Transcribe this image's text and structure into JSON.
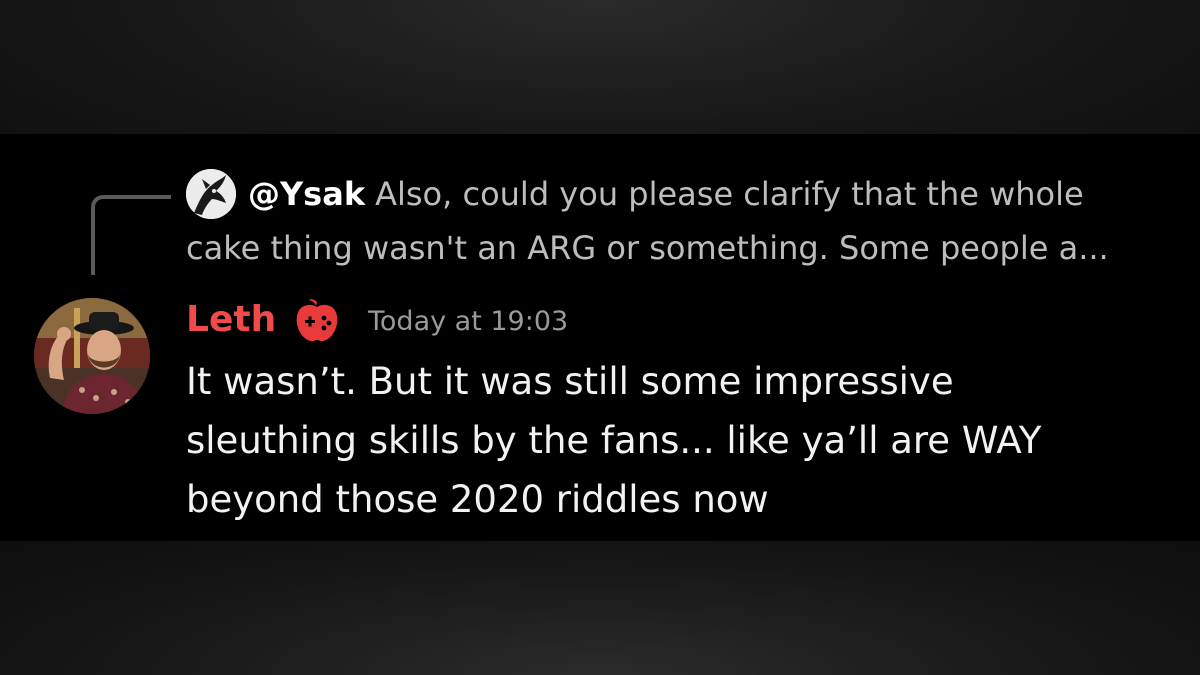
{
  "reply": {
    "username": "@Ysak",
    "text_line1": "Also, could you please clarify that the whole",
    "text_line2": "cake thing wasn't an ARG or something. Some people a..."
  },
  "message": {
    "author": "Leth",
    "timestamp": "Today at 19:03",
    "lines": [
      "It wasn’t. But it was still some impressive",
      "sleuthing skills by the fans... like ya’ll are WAY",
      "beyond those 2020 riddles now"
    ]
  },
  "icons": {
    "reply_connector": "reply-connector-line",
    "role_badge": "red-gamepad-apple-icon"
  },
  "colors": {
    "author_name": "#f04a4a",
    "timestamp": "#9a9a9a",
    "reply_text": "#bdbdbd",
    "message_text": "#f2f2f2",
    "panel_bg": "#000000"
  }
}
